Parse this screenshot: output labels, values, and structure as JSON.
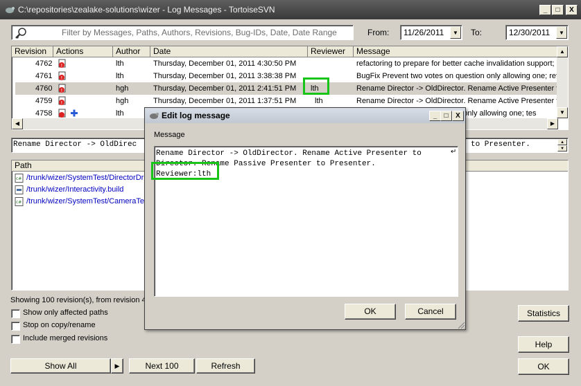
{
  "window": {
    "title": "C:\\repositories\\zealake-solutions\\wizer - Log Messages - TortoiseSVN",
    "minimize": "_",
    "maximize": "□",
    "close": "X"
  },
  "filter": {
    "placeholder": "Filter by Messages, Paths, Authors, Revisions, Bug-IDs, Date, Date Range",
    "from_label": "From:",
    "from_value": "11/26/2011",
    "to_label": "To:",
    "to_value": "12/30/2011"
  },
  "log_table": {
    "columns": [
      "Revision",
      "Actions",
      "Author",
      "Date",
      "Reviewer",
      "Message"
    ],
    "rows": [
      {
        "revision": "4762",
        "author": "lth",
        "date": "Thursday, December 01, 2011 4:30:50 PM",
        "reviewer": "",
        "message": "refactoring to prepare for better cache invalidation support;"
      },
      {
        "revision": "4761",
        "author": "lth",
        "date": "Thursday, December 01, 2011 3:38:38 PM",
        "reviewer": "",
        "message": "BugFix Prevent two votes on question only allowing one; refa"
      },
      {
        "revision": "4760",
        "author": "hgh",
        "date": "Thursday, December 01, 2011 2:41:51 PM",
        "reviewer": "lth",
        "message": "Rename Director -> OldDirector. Rename Active Presenter to"
      },
      {
        "revision": "4759",
        "author": "hgh",
        "date": "Thursday, December 01, 2011 1:37:51 PM",
        "reviewer": "lth",
        "message": "Rename Director -> OldDirector. Rename Active Presenter to"
      },
      {
        "revision": "4758",
        "author": "lth",
        "date": "",
        "reviewer": "",
        "message": "stion only allowing one; tes"
      }
    ]
  },
  "message_preview": {
    "left": "Rename Director -> OldDirec",
    "right": "to Presenter."
  },
  "paths": {
    "header": "Path",
    "items": [
      "/trunk/wizer/SystemTest/DirectorDr",
      "/trunk/wizer/Interactivity.build",
      "/trunk/wizer/SystemTest/CameraTe"
    ]
  },
  "status": {
    "showing": "Showing 100 revision(s), from revision 4"
  },
  "options": {
    "affected_paths": "Show only affected paths",
    "stop_copy": "Stop on copy/rename",
    "merged": "Include merged revisions"
  },
  "buttons": {
    "show_all": "Show All",
    "next_100": "Next 100",
    "refresh": "Refresh",
    "statistics": "Statistics",
    "help": "Help",
    "ok": "OK"
  },
  "dialog": {
    "title": "Edit log message",
    "message_label": "Message",
    "text_line1": "Rename Director -> OldDirector. Rename Active Presenter to",
    "text_line2": "Director. Rename Passive Presenter to Presenter.",
    "text_line3": "Reviewer:lth",
    "ok": "OK",
    "cancel": "Cancel"
  },
  "colors": {
    "highlight": "#19c419",
    "link": "#0000c0",
    "titlebar": "#4a4a4a"
  }
}
